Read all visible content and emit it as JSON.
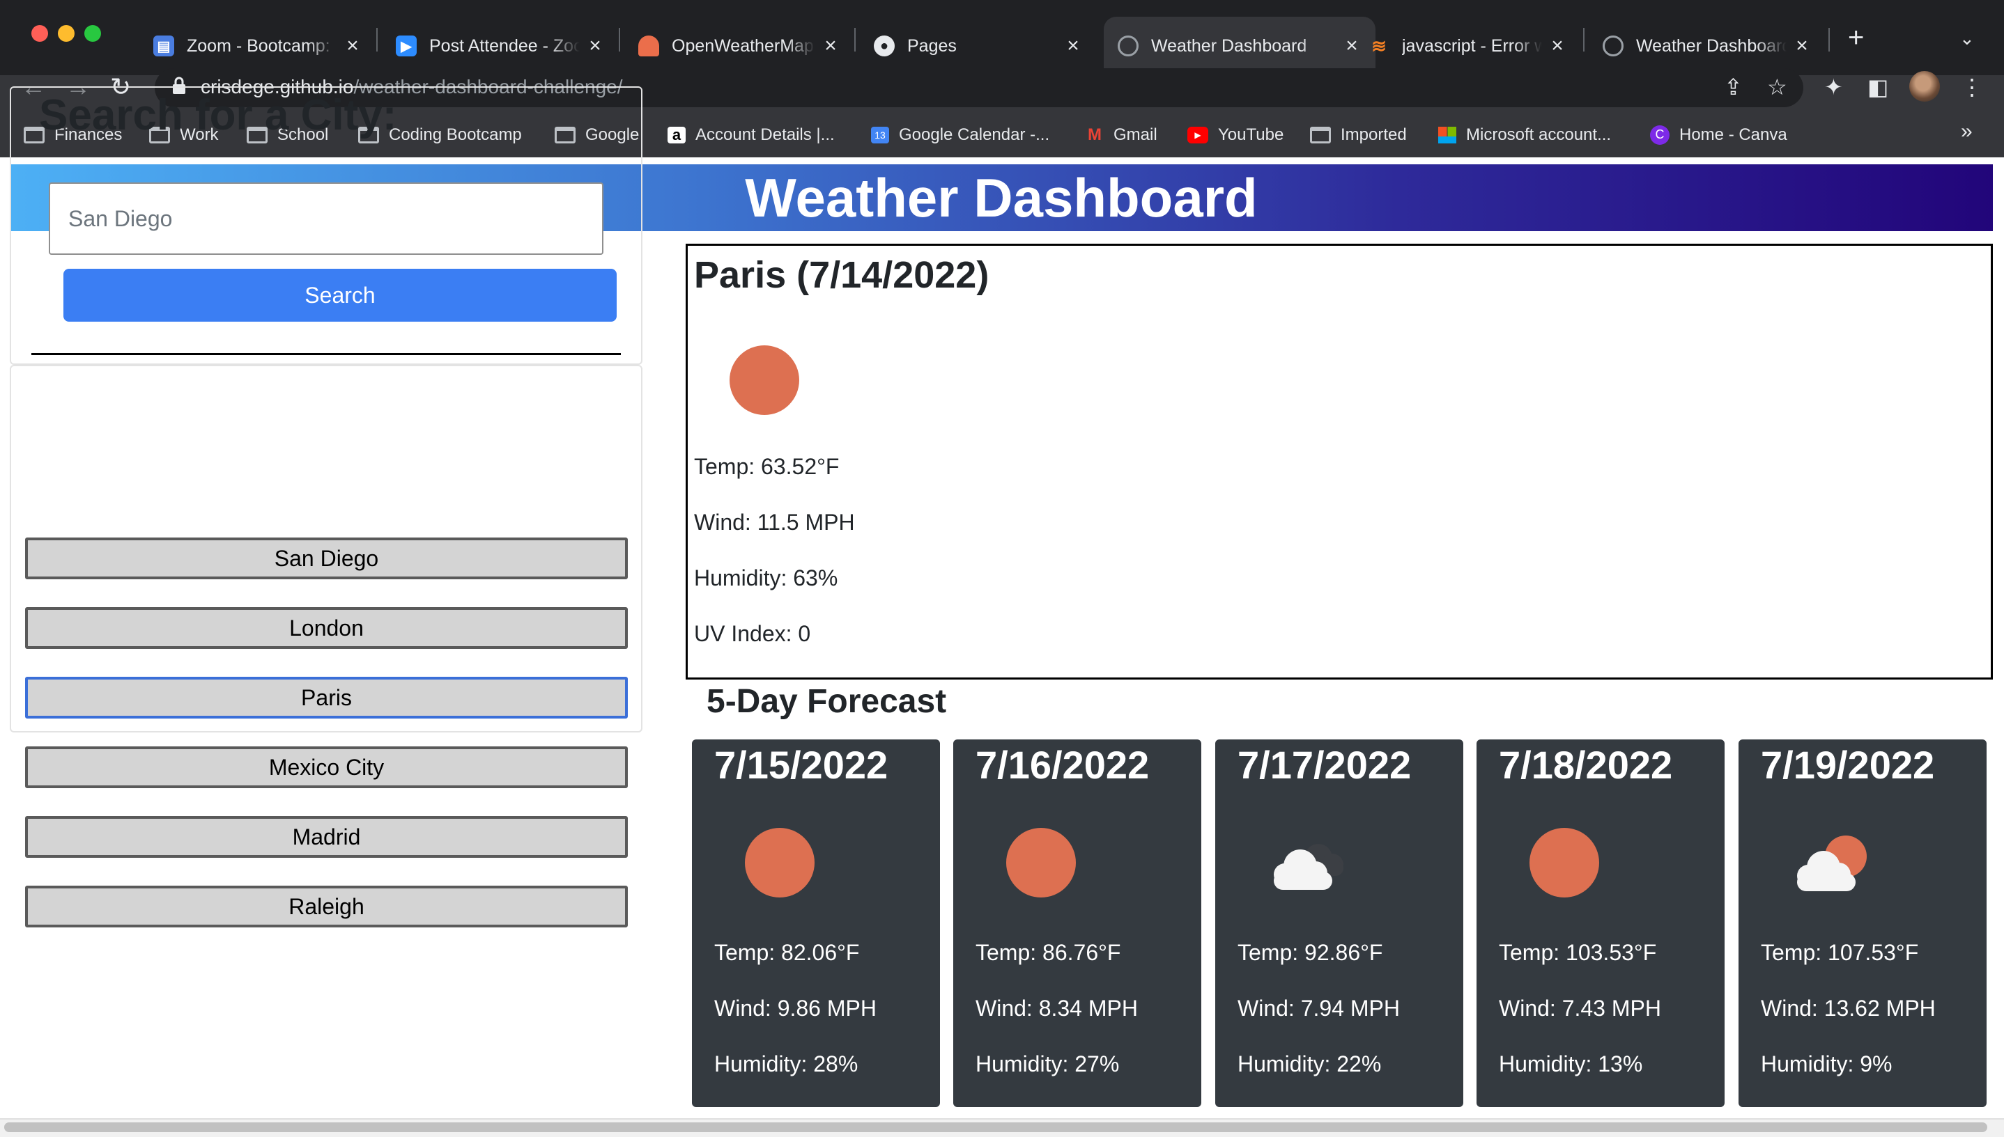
{
  "browser": {
    "tabs": [
      {
        "title": "Zoom - Bootcamp: ",
        "icon": "document-icon",
        "active": false
      },
      {
        "title": "Post Attendee - Zoom",
        "icon": "zoom-icon",
        "active": false
      },
      {
        "title": "OpenWeatherMap API",
        "icon": "openweathermap-icon",
        "active": false
      },
      {
        "title": "Pages",
        "icon": "github-icon",
        "active": false
      },
      {
        "title": "Weather Dashboard",
        "icon": "globe-icon",
        "active": true
      },
      {
        "title": "javascript - Error with",
        "icon": "stackoverflow-icon",
        "active": false
      },
      {
        "title": "Weather Dashboard",
        "icon": "globe-icon",
        "active": false
      }
    ],
    "url_host": "crisdege.github.io",
    "url_path": "/weather-dashboard-challenge/",
    "bookmarks": [
      {
        "label": "Finances",
        "icon": "folder-icon"
      },
      {
        "label": "Work",
        "icon": "folder-icon"
      },
      {
        "label": "School",
        "icon": "folder-icon"
      },
      {
        "label": "Coding Bootcamp",
        "icon": "folder-icon"
      },
      {
        "label": "Google",
        "icon": "folder-icon"
      },
      {
        "label": "Account Details |...",
        "icon": "amazon-icon"
      },
      {
        "label": "Google Calendar -...",
        "icon": "calendar-icon"
      },
      {
        "label": "Gmail",
        "icon": "gmail-icon"
      },
      {
        "label": "YouTube",
        "icon": "youtube-icon"
      },
      {
        "label": "Imported",
        "icon": "folder-icon"
      },
      {
        "label": "Microsoft account...",
        "icon": "microsoft-icon"
      },
      {
        "label": "Home - Canva",
        "icon": "canva-icon"
      }
    ]
  },
  "page": {
    "header_title": "Weather Dashboard",
    "search": {
      "heading": "Search for a City:",
      "value": "",
      "placeholder": "San Diego",
      "button_label": "Search"
    },
    "history": [
      "San Diego",
      "London",
      "Paris",
      "Mexico City",
      "Madrid",
      "Raleigh"
    ],
    "history_focused": "Paris",
    "current": {
      "title": "Paris (7/14/2022)",
      "icon": "sun-icon",
      "temp": "Temp: 63.52°F",
      "wind": "Wind: 11.5 MPH",
      "humidity": "Humidity: 63%",
      "uv": "UV Index: 0"
    },
    "forecast_title": "5-Day Forecast",
    "forecast": [
      {
        "date": "7/15/2022",
        "icon": "sun-icon",
        "temp": "Temp: 82.06°F",
        "wind": "Wind: 9.86 MPH",
        "humidity": "Humidity: 28%"
      },
      {
        "date": "7/16/2022",
        "icon": "sun-icon",
        "temp": "Temp: 86.76°F",
        "wind": "Wind: 8.34 MPH",
        "humidity": "Humidity: 27%"
      },
      {
        "date": "7/17/2022",
        "icon": "clouds-icon",
        "temp": "Temp: 92.86°F",
        "wind": "Wind: 7.94 MPH",
        "humidity": "Humidity: 22%"
      },
      {
        "date": "7/18/2022",
        "icon": "sun-icon",
        "temp": "Temp: 103.53°F",
        "wind": "Wind: 7.43 MPH",
        "humidity": "Humidity: 13%"
      },
      {
        "date": "7/19/2022",
        "icon": "partly-cloudy-icon",
        "temp": "Temp: 107.53°F",
        "wind": "Wind: 13.62 MPH",
        "humidity": "Humidity: 9%"
      }
    ],
    "colors": {
      "banner_start": "#4db0f5",
      "banner_end": "#22057a",
      "search_button": "#3b7ef3",
      "forecast_card": "#343a40",
      "sun": "#dd7051"
    }
  }
}
